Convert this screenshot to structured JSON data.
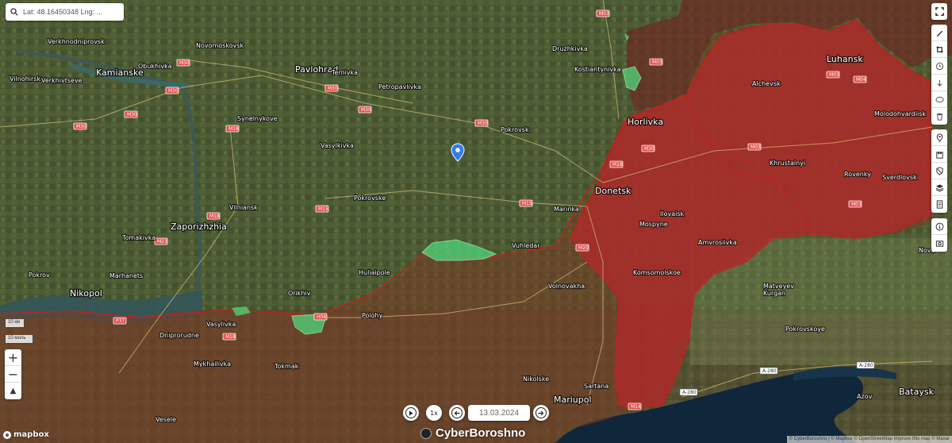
{
  "search": {
    "value": "Lat: 48.16450348 Lng: ..."
  },
  "cities": {
    "verkhnodniprovsk": "Verkhnodniprovsk",
    "kamianske": "Kamianske",
    "obukhivka": "Obukhivka",
    "vilnohirsk": "Vilnohirsk",
    "verkhivtseve": "Verkhivtseve",
    "novomoskovsk": "Novomoskovsk",
    "pavlohrad": "Pavlohrad",
    "ternivka": "Ternivka",
    "petropavlivka": "Petropavlivka",
    "synelnykove": "Synelnykove",
    "vasylkivka": "Vasylkivka",
    "pokrovsk": "Pokrovsk",
    "druzhkivka": "Druzhkivka",
    "kostiantynivka": "Kostiantynivka",
    "horlivka": "Horlivka",
    "luhansk": "Luhansk",
    "alchevsk": "Alchevsk",
    "molodohvardiisk": "Molodohvardiisk",
    "khrustalnyi": "Khrustalnyi",
    "rovenky": "Rovenky",
    "sverdlovsk": "Sverdlovsk",
    "donetsk": "Donetsk",
    "marinka": "Marinka",
    "ilovaisk": "Ilovaisk",
    "mospyne": "Mospyne",
    "amvrosiivka": "Amvrosiivka",
    "komsomolskoe": "Komsomolskoe",
    "vuhledar": "Vuhledar",
    "pokrovske": "Pokrovske",
    "vilniansk": "Vilniansk",
    "zaporizhzhia": "Zaporizhzhia",
    "tomakivka": "Tomakivka",
    "marhanets": "Marhanets",
    "pokrov": "Pokrov",
    "nikopol": "Nikopol",
    "huliaipole": "Huliaipole",
    "orikhiv": "Orikhiv",
    "polohy": "Polohy",
    "vasylivka": "Vasylivka",
    "dniprorudne": "Dniprorudne",
    "mykhailivka": "Mykhailivka",
    "tokmak": "Tokmak",
    "vesele": "Vesele",
    "volnovakha": "Volnovakha",
    "nikolske": "Nikolske",
    "sartana": "Sartana",
    "mariupol": "Mariupol",
    "matveyev_kurgan": "Matveyev\nKurgan",
    "pokrovskoye": "Pokrovskoye",
    "azov": "Azov",
    "bataysk": "Bataysk",
    "novo": "Novo"
  },
  "roads": {
    "m03a": "M03",
    "m03b": "M03",
    "m03c": "M03",
    "m03d": "M03",
    "m03e": "M03",
    "m30a": "M30",
    "m30b": "M30",
    "m30c": "M30",
    "m30d": "M30",
    "m30e": "M30",
    "m30f": "M30",
    "m30g": "M30",
    "m30h": "M30",
    "m18a": "M18",
    "m18b": "M18",
    "m18c": "M18",
    "m18d": "M18",
    "m15a": "M15",
    "m15b": "M15",
    "m04": "M04",
    "m14": "M14",
    "m20": "M20",
    "m23": "M23",
    "p37": "P37",
    "h08": "H08",
    "a280a": "A-280",
    "a280b": "A-280",
    "a280c": "A-280"
  },
  "scale": {
    "km": "10 км",
    "mi": "10 миль"
  },
  "zoom": {
    "in": "+",
    "out": "−",
    "north": "▲"
  },
  "timeline": {
    "speed": "1x",
    "date": "13.03.2024"
  },
  "brand": {
    "name": "CyberBoroshno"
  },
  "mapbox": {
    "label": "mapbox"
  },
  "attribution": "© CyberBoroshno | © Mapbox © OpenStreetMap Improve this map © Maxar",
  "colors": {
    "occupied": "#b02a2a",
    "liberated": "#4fd87b",
    "border": "#c81e1e"
  }
}
